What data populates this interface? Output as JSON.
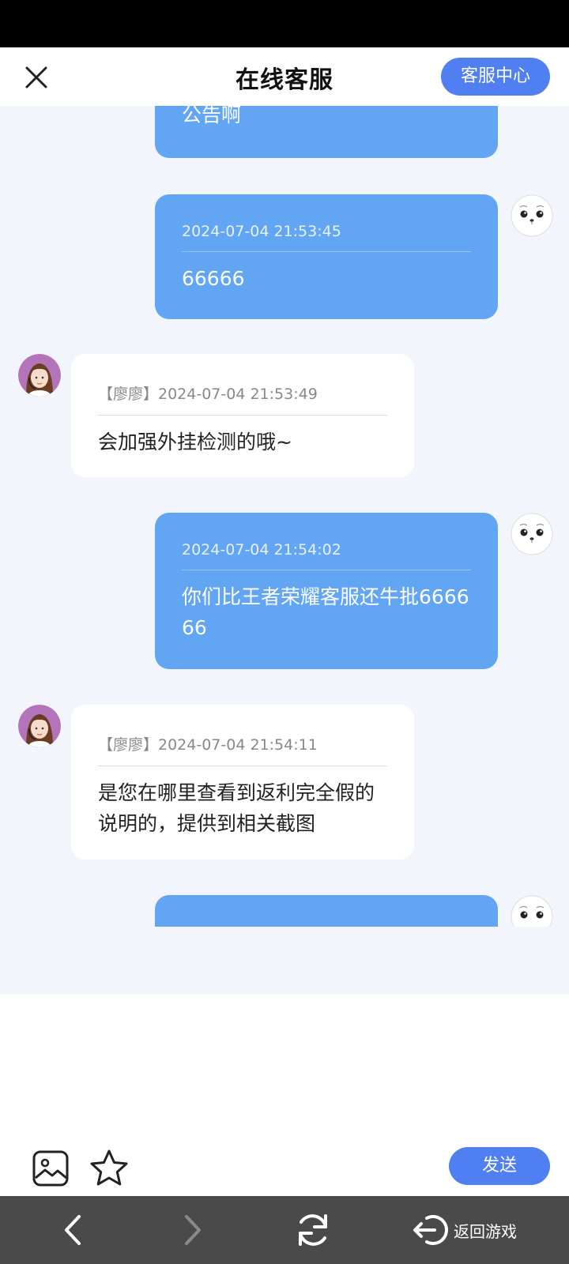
{
  "header": {
    "title": "在线客服",
    "service_center": "客服中心"
  },
  "messages": [
    {
      "from": "me",
      "time": "",
      "text": "公告啊"
    },
    {
      "from": "me",
      "time": "2024-07-04 21:53:45",
      "text": "66666"
    },
    {
      "from": "cs",
      "time": "【廖廖】2024-07-04 21:53:49",
      "text": "会加强外挂检测的哦~"
    },
    {
      "from": "me",
      "time": "2024-07-04 21:54:02",
      "text": "你们比王者荣耀客服还牛批666666"
    },
    {
      "from": "cs",
      "time": "【廖廖】2024-07-04 21:54:11",
      "text": "是您在哪里查看到返利完全假的说明的，提供到相关截图"
    }
  ],
  "composer": {
    "send": "发送",
    "icons": [
      "image-icon",
      "star-icon"
    ]
  },
  "navbar": {
    "back_game": "返回游戏",
    "icons": [
      "back-arrow-icon",
      "forward-arrow-icon",
      "refresh-icon",
      "exit-icon"
    ]
  },
  "colors": {
    "accent": "#4f7ff0",
    "my_bubble": "#62a5f3",
    "chat_bg": "#f2f5fb",
    "navbar": "#4a4a4a"
  }
}
